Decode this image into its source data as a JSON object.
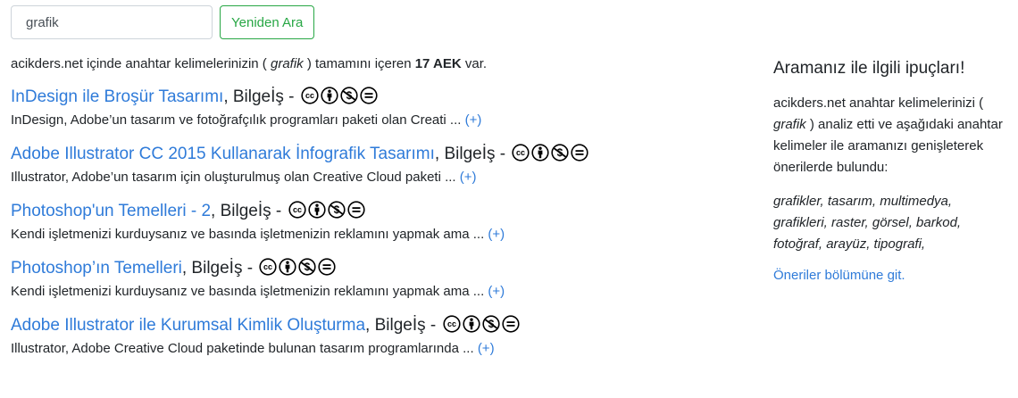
{
  "search": {
    "value": "grafik",
    "button_label": "Yeniden Ara"
  },
  "summary": {
    "prefix": "acikders.net içinde anahtar kelimelerinizin ( ",
    "query": "grafik",
    "middle": " ) tamamını içeren ",
    "count": "17 AEK",
    "suffix": " var."
  },
  "results": [
    {
      "title": "InDesign ile Broşür Tasarımı",
      "author": ", Bilgeİş -",
      "snippet": "InDesign, Adobe’un tasarım ve fotoğrafçılık programları paketi olan Creati ...",
      "more": "(+)"
    },
    {
      "title": "Adobe Illustrator CC 2015 Kullanarak İnfografik Tasarımı",
      "author": ", Bilgeİş -",
      "snippet": "Illustrator, Adobe’un tasarım için oluşturulmuş olan Creative Cloud paketi ...",
      "more": "(+)"
    },
    {
      "title": "Photoshop'un Temelleri - 2",
      "author": ", Bilgeİş -",
      "snippet": "Kendi işletmenizi kurduysanız ve basında işletmenizin reklamını yapmak ama ...",
      "more": "(+)"
    },
    {
      "title": "Photoshop’ın Temelleri",
      "author": ", Bilgeİş -",
      "snippet": "Kendi işletmenizi kurduysanız ve basında işletmenizin reklamını yapmak ama ...",
      "more": "(+)"
    },
    {
      "title": "Adobe Illustrator ile Kurumsal Kimlik Oluşturma",
      "author": ", Bilgeİş -",
      "snippet": "Illustrator, Adobe Creative Cloud paketinde bulunan tasarım programlarında ...",
      "more": "(+)"
    }
  ],
  "license_icons": [
    "cc-icon",
    "by-icon",
    "nc-icon",
    "nd-icon"
  ],
  "sidebar": {
    "title": "Aramanız ile ilgili ipuçları!",
    "text_before": "acikders.net anahtar kelimelerinizi ( ",
    "query": "grafik",
    "text_after": " ) analiz etti ve aşağıdaki anahtar kelimeler ile aramanızı genişleterek önerilerde bulundu:",
    "tags": "grafikler, tasarım, multimedya, grafikleri, raster, görsel, barkod, fotoğraf, arayüz, tipografi,",
    "link": "Öneriler bölümüne git."
  },
  "colors": {
    "link": "#2f7bd9",
    "success": "#28a745",
    "text": "#212529"
  }
}
